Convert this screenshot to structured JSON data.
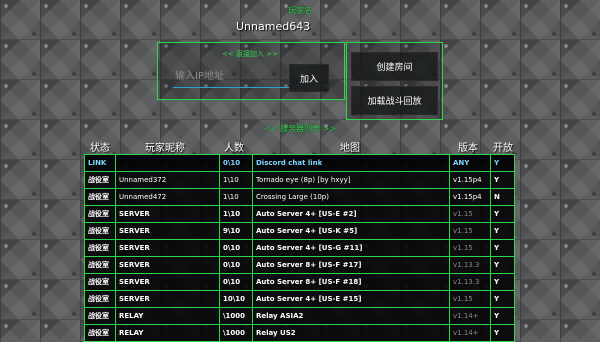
{
  "header": {
    "player_label": "玩家名",
    "player_name": "Unnamed643"
  },
  "direct_join": {
    "title": "<< 直接加入 >>",
    "input_placeholder": "输入IP地址",
    "join_label": "加入"
  },
  "actions": {
    "create_room": "创建房间",
    "load_replay": "加载战斗回放"
  },
  "server_list": {
    "title": "<< 服务器列表 >>",
    "columns": [
      "状态",
      "玩家昵称",
      "人数",
      "地图",
      "版本",
      "开放"
    ],
    "rows": [
      {
        "status": "LINK",
        "player": "",
        "count": "0\\10",
        "map": "Discord chat link",
        "version": "ANY",
        "open": "Y",
        "style": "link"
      },
      {
        "status": "战役室",
        "player": "Unnamed372",
        "count": "1\\10",
        "map": "Tornado eye (8p) [by hxyy]",
        "version": "v1.15p4",
        "open": "Y",
        "style": "user"
      },
      {
        "status": "战役室",
        "player": "Unnamed472",
        "count": "1\\10",
        "map": "Crossing Large (10p)",
        "version": "v1.15p4",
        "open": "N",
        "style": "user"
      },
      {
        "status": "战役室",
        "player": "SERVER",
        "count": "1\\10",
        "map": "Auto Server 4+ [US-E #2]",
        "version": "v1.15",
        "open": "Y",
        "style": "server"
      },
      {
        "status": "战役室",
        "player": "SERVER",
        "count": "9\\10",
        "map": "Auto Server 4+ [US-K #5]",
        "version": "v1.15",
        "open": "Y",
        "style": "server"
      },
      {
        "status": "战役室",
        "player": "SERVER",
        "count": "0\\10",
        "map": "Auto Server 4+ [US-G #11]",
        "version": "v1.15",
        "open": "Y",
        "style": "server"
      },
      {
        "status": "战役室",
        "player": "SERVER",
        "count": "0\\10",
        "map": "Auto Server 8+ [US-F #17]",
        "version": "v1.13.3",
        "open": "Y",
        "style": "server"
      },
      {
        "status": "战役室",
        "player": "SERVER",
        "count": "0\\10",
        "map": "Auto Server 8+ [US-F #18]",
        "version": "v1.13.3",
        "open": "Y",
        "style": "server"
      },
      {
        "status": "战役室",
        "player": "SERVER",
        "count": "10\\10",
        "map": "Auto Server 4+ [US-E #15]",
        "version": "v1.15",
        "open": "Y",
        "style": "server"
      },
      {
        "status": "战役室",
        "player": "RELAY",
        "count": "\\1000",
        "map": "Relay ASIA2",
        "version": "v1.14+",
        "open": "Y",
        "style": "server"
      },
      {
        "status": "战役室",
        "player": "RELAY",
        "count": "\\1000",
        "map": "Relay US2",
        "version": "v1.14+",
        "open": "Y",
        "style": "server"
      }
    ]
  },
  "colors": {
    "accent_green": "#2cd84a",
    "link_cyan": "#7fd6ff",
    "dim_version": "#8a8a8a",
    "input_underline": "#2aa0d8"
  }
}
